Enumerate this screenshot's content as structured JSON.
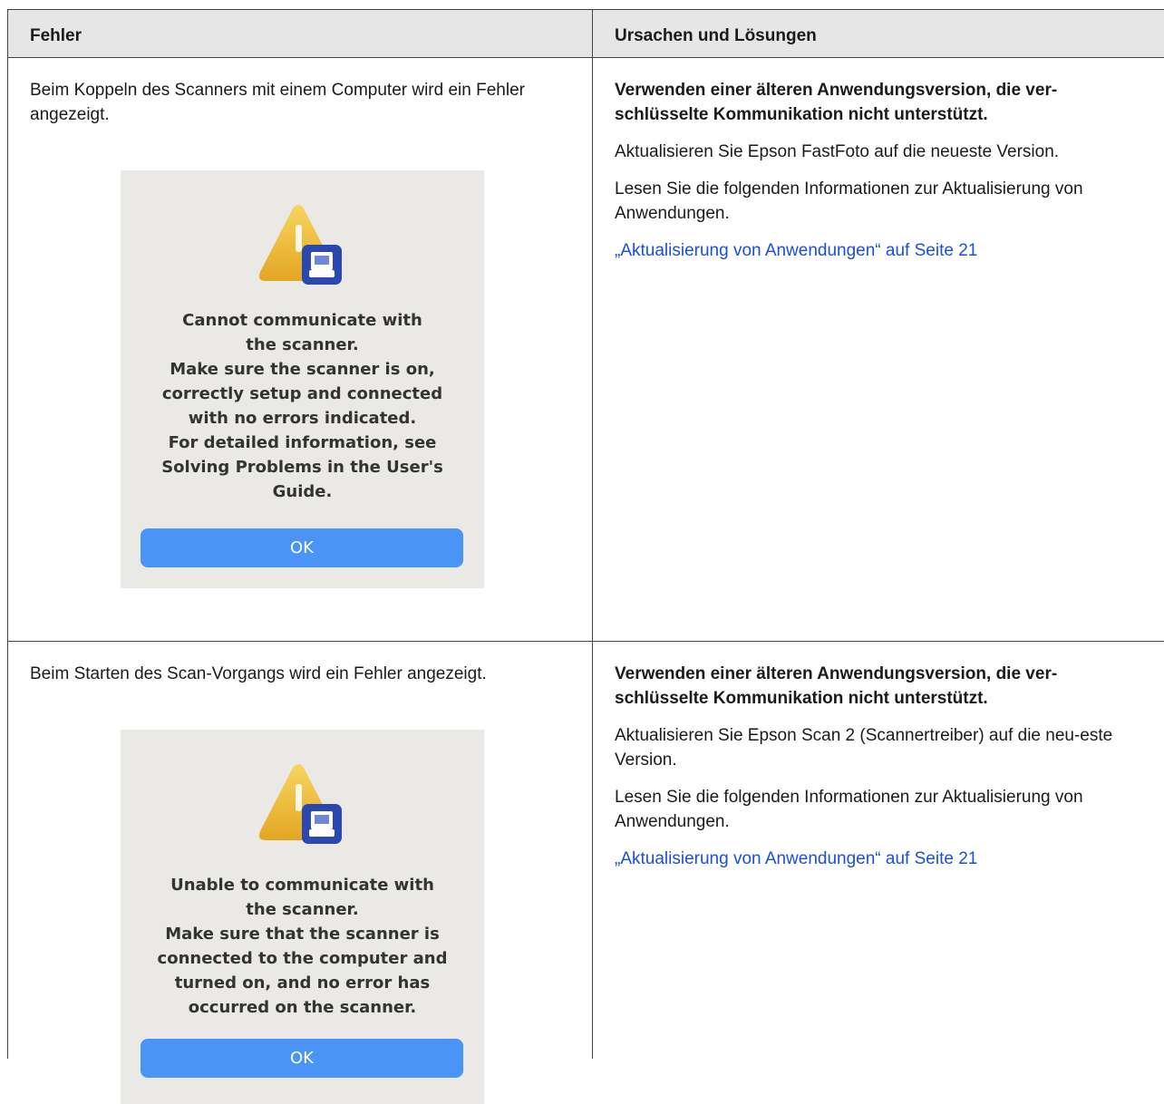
{
  "table": {
    "headers": [
      "Fehler",
      "Ursachen und Lösungen"
    ],
    "rows": [
      {
        "error_text": "Beim Koppeln des Scanners mit einem Computer wird ein Fehler angezeigt.",
        "dialog": {
          "message": "Cannot communicate with\nthe scanner.\nMake sure the scanner is on,\ncorrectly setup and connected\nwith no errors indicated.\nFor detailed information, see\nSolving Problems in the User's\nGuide.",
          "ok_label": "OK"
        },
        "cause_title": "Verwenden einer älteren Anwendungsversion, die ver-schlüsselte Kommunikation nicht unterstützt.",
        "solution": "Aktualisieren Sie Epson FastFoto auf die neueste Version.",
        "info": "Lesen Sie die folgenden Informationen zur Aktualisierung von Anwendungen.",
        "link": "„Aktualisierung von Anwendungen“ auf Seite 21"
      },
      {
        "error_text": "Beim Starten des Scan-Vorgangs wird ein Fehler angezeigt.",
        "dialog": {
          "message": "Unable to communicate with\nthe scanner.\nMake sure that the scanner is\nconnected to the computer and\nturned on, and no error has\noccurred on the scanner.",
          "ok_label": "OK"
        },
        "cause_title": "Verwenden einer älteren Anwendungsversion, die ver-schlüsselte Kommunikation nicht unterstützt.",
        "solution": "Aktualisieren Sie Epson Scan 2 (Scannertreiber) auf die neu-este Version.",
        "info": "Lesen Sie die folgenden Informationen zur Aktualisierung von Anwendungen.",
        "link": "„Aktualisierung von Anwendungen“ auf Seite 21"
      }
    ]
  },
  "colors": {
    "header_bg": "#e6e6e6",
    "link": "#1a4fd6",
    "dialog_bg": "#ebe9e6",
    "ok_button": "#4a93f7",
    "warning_yellow": "#f2c13a",
    "scanner_badge": "#2a48b0"
  },
  "icons": [
    "warning-icon",
    "scanner-icon"
  ]
}
